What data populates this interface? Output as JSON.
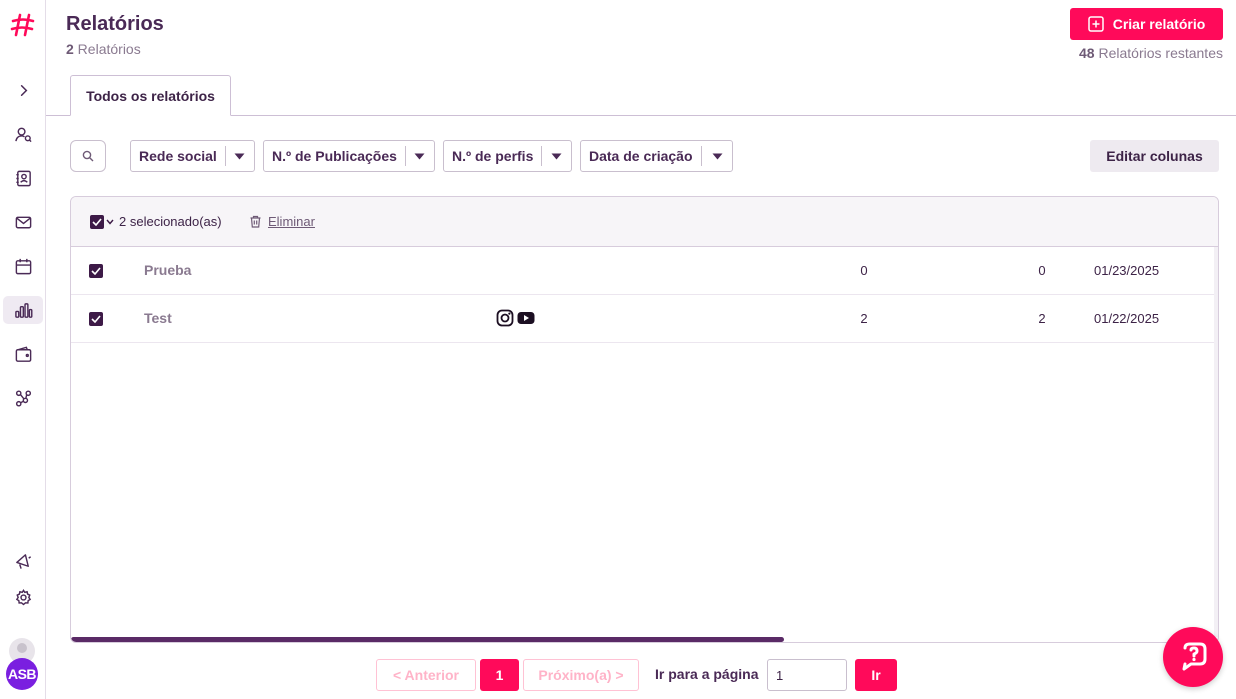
{
  "sidebar": {
    "logo": "hashtag-logo-icon",
    "items": [
      {
        "name": "expand",
        "icon": "chevron-right-icon"
      },
      {
        "name": "users",
        "icon": "user-search-icon"
      },
      {
        "name": "contacts",
        "icon": "contact-book-icon"
      },
      {
        "name": "messages",
        "icon": "mail-icon"
      },
      {
        "name": "calendar",
        "icon": "calendar-icon"
      },
      {
        "name": "reports",
        "icon": "bar-chart-icon",
        "active": true
      },
      {
        "name": "wallet",
        "icon": "wallet-icon"
      },
      {
        "name": "integrations",
        "icon": "nodes-icon"
      },
      {
        "name": "announcements",
        "icon": "megaphone-icon"
      },
      {
        "name": "settings",
        "icon": "gear-icon"
      }
    ],
    "avatar_initials": "ASB"
  },
  "header": {
    "title": "Relatórios",
    "count": "2",
    "count_label": " Relatórios",
    "create_label": "Criar relatório",
    "remaining_count": "48",
    "remaining_label": " Relatórios restantes"
  },
  "tabs": [
    {
      "label": "Todos os relatórios",
      "active": true
    }
  ],
  "filters": {
    "social": "Rede social",
    "posts": "N.º de Publicações",
    "profiles": "N.º de perfis",
    "created": "Data de criação",
    "edit_columns": "Editar colunas"
  },
  "table": {
    "selected_label": "2 selecionado(as)",
    "delete_label": "Eliminar",
    "rows": [
      {
        "name": "Prueba",
        "networks": [],
        "publications": "0",
        "profiles": "0",
        "date": "01/23/2025",
        "checked": true
      },
      {
        "name": "Test",
        "networks": [
          "instagram-icon",
          "youtube-icon"
        ],
        "publications": "2",
        "profiles": "2",
        "date": "01/22/2025",
        "checked": true
      }
    ]
  },
  "pagination": {
    "prev": "< Anterior",
    "current": "1",
    "next": "Próximo(a) >",
    "goto_label": "Ir para a página",
    "goto_value": "1",
    "go": "Ir"
  },
  "colors": {
    "accent": "#ff0a5a",
    "brand_dark": "#3d1a47",
    "avatar": "#7a1fe0"
  }
}
